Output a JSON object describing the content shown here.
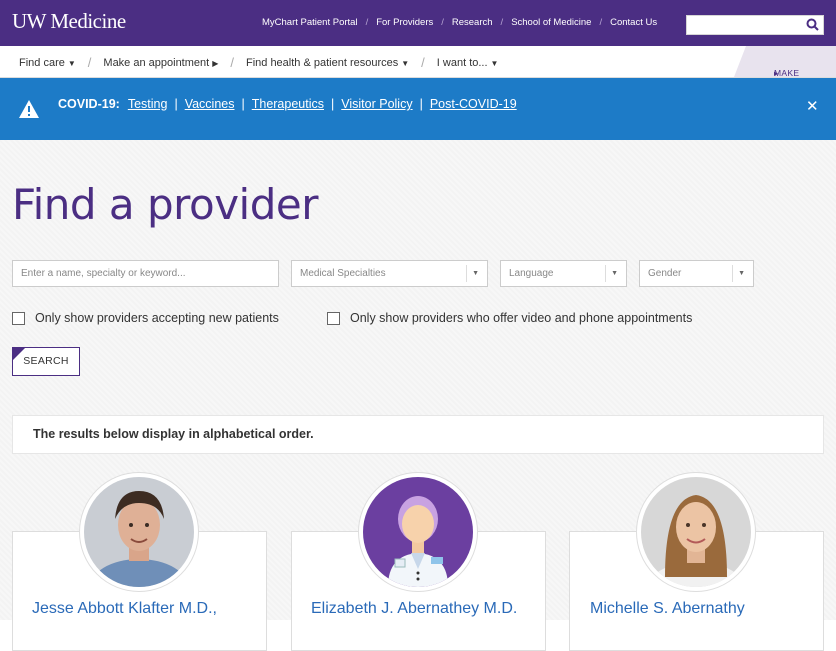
{
  "brand": {
    "logo_text": "UW Medicine"
  },
  "top_links": [
    "MyChart Patient Portal",
    "For Providers",
    "Research",
    "School of Medicine",
    "Contact Us"
  ],
  "nav": {
    "items": [
      {
        "label": "Find care",
        "caret": "chevron-down"
      },
      {
        "label": "Make an appointment",
        "caret": "chevron-right"
      },
      {
        "label": "Find health & patient resources",
        "caret": "chevron-down"
      },
      {
        "label": "I want to...",
        "caret": "chevron-down"
      }
    ],
    "gift_label": "MAKE A GIFT"
  },
  "alert": {
    "label": "COVID-19:",
    "links": [
      "Testing",
      "Vaccines",
      "Therapeutics",
      "Visitor Policy",
      "Post-COVID-19"
    ],
    "close_glyph": "✕"
  },
  "page": {
    "title": "Find a provider",
    "search_placeholder": "Enter a name, specialty or keyword...",
    "filters": {
      "specialty": "Medical Specialties",
      "language": "Language",
      "gender": "Gender"
    },
    "checkbox_new_patients": "Only show providers accepting new patients",
    "checkbox_video": "Only show providers who offer video and phone appointments",
    "search_button": "SEARCH",
    "results_note": "The results below display in alphabetical order."
  },
  "providers": [
    {
      "name": "Jesse Abbott Klafter M.D.,",
      "photo": "photo"
    },
    {
      "name": "Elizabeth J. Abernathey M.D.",
      "photo": "placeholder-illustration"
    },
    {
      "name": "Michelle S. Abernathy",
      "photo": "photo"
    }
  ],
  "colors": {
    "brand_purple": "#4b2e83",
    "alert_blue": "#1d7bc7",
    "link_blue": "#2a6ab8"
  }
}
